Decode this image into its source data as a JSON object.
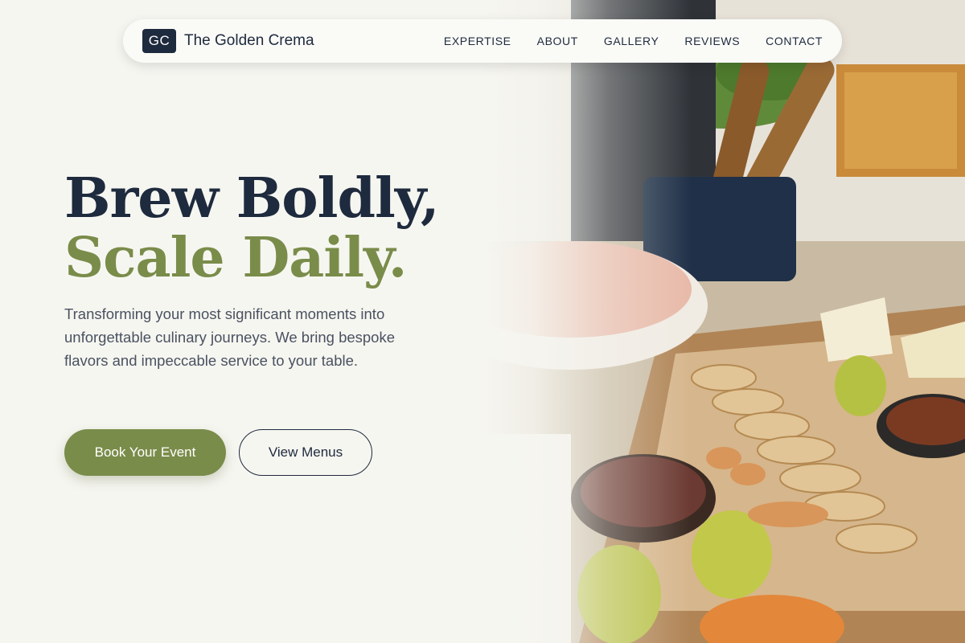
{
  "brand": {
    "badge": "GC",
    "name": "The Golden Crema"
  },
  "nav": {
    "items": [
      {
        "label": "EXPERTISE"
      },
      {
        "label": "ABOUT"
      },
      {
        "label": "GALLERY"
      },
      {
        "label": "REVIEWS"
      },
      {
        "label": "CONTACT"
      }
    ]
  },
  "hero": {
    "headline_line1": "Brew Boldly,",
    "headline_line2": "Scale Daily.",
    "subtext": "Transforming your most significant moments into unforgettable culinary journeys. We bring bespoke flavors and impeccable service to your table.",
    "primary_cta": "Book Your Event",
    "secondary_cta": "View Menus",
    "image_subject": "catering-buffet-photo"
  },
  "colors": {
    "navy": "#1e2a3d",
    "olive": "#7a8c4a",
    "background": "#f6f6f1"
  }
}
